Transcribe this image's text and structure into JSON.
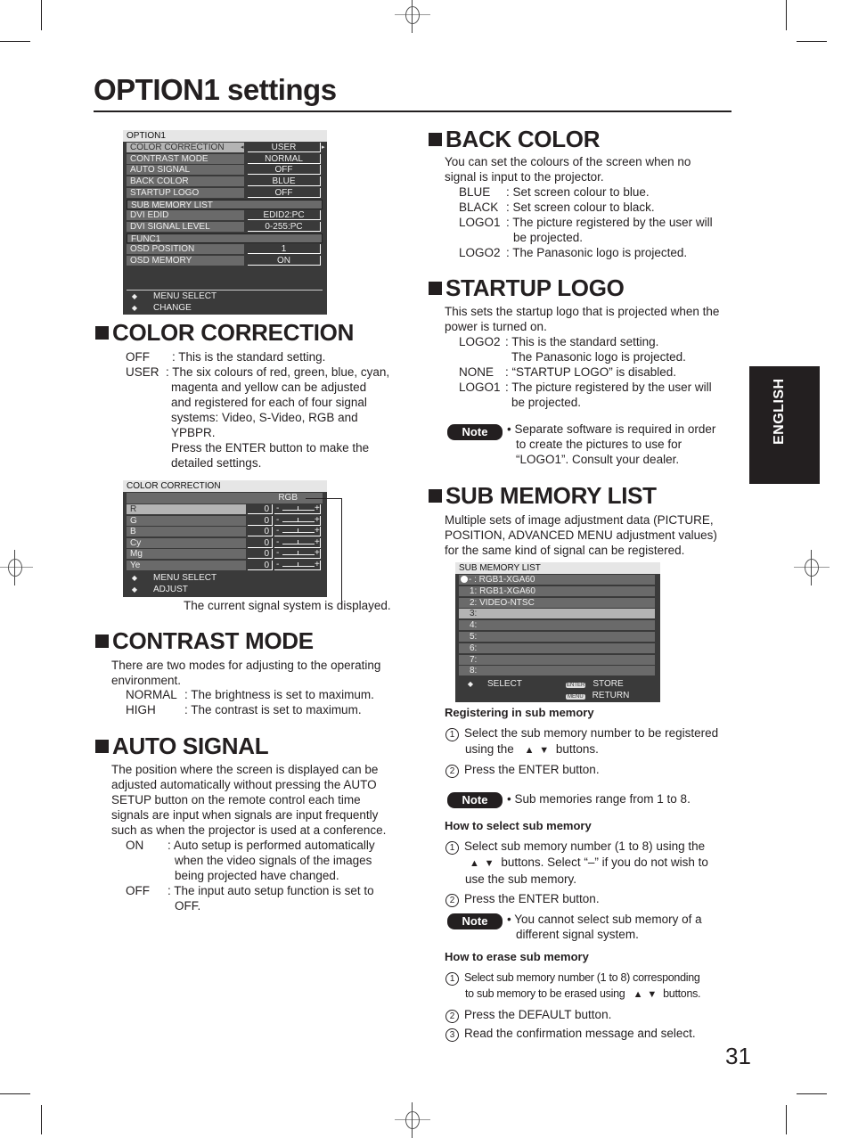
{
  "page": {
    "title": "OPTION1 settings",
    "page_number": "31",
    "language_tab": "ENGLISH"
  },
  "option1_menu": {
    "header": "OPTION1",
    "rows": [
      {
        "label": "COLOR CORRECTION",
        "value": "USER",
        "selected": true
      },
      {
        "label": "CONTRAST MODE",
        "value": "NORMAL"
      },
      {
        "label": "AUTO SIGNAL",
        "value": "OFF"
      },
      {
        "label": "BACK COLOR",
        "value": "BLUE"
      },
      {
        "label": "STARTUP LOGO",
        "value": "OFF"
      },
      {
        "label": "SUB MEMORY LIST",
        "value": ""
      },
      {
        "label": "DVI EDID",
        "value": "EDID2:PC"
      },
      {
        "label": "DVI SIGNAL LEVEL",
        "value": "0-255:PC"
      },
      {
        "label": "FUNC1",
        "value": ""
      },
      {
        "label": "OSD POSITION",
        "value": "1"
      },
      {
        "label": "OSD MEMORY",
        "value": "ON"
      }
    ],
    "footer": [
      {
        "icon": "up-down-arrows-icon",
        "label": "MENU SELECT"
      },
      {
        "icon": "left-right-arrows-icon",
        "label": "CHANGE"
      }
    ]
  },
  "color_correction": {
    "heading": "COLOR CORRECTION",
    "defs": [
      {
        "key": "OFF",
        "text": ": This is the standard setting."
      },
      {
        "key": "USER",
        "text": ": The six colours of red, green, blue, cyan, magenta and yellow can be adjusted and registered for each of four signal systems: Video, S-Video, RGB and YPBPR. Press the ENTER button to make the detailed settings."
      }
    ],
    "user_lines": [
      ": The six colours of red, green, blue, cyan,",
      "magenta and yellow can be adjusted",
      "and registered for each of four signal",
      "systems: Video, S-Video, RGB and",
      "YPBPR.",
      "Press the ENTER button to make the",
      "detailed settings."
    ],
    "menu": {
      "header": "COLOR CORRECTION",
      "signal": "RGB",
      "rows": [
        {
          "label": "R",
          "value": "0"
        },
        {
          "label": "G",
          "value": "0"
        },
        {
          "label": "B",
          "value": "0"
        },
        {
          "label": "Cy",
          "value": "0"
        },
        {
          "label": "Mg",
          "value": "0"
        },
        {
          "label": "Ye",
          "value": "0"
        }
      ],
      "slider_minus": "-",
      "slider_plus": "+",
      "footer": [
        {
          "icon": "up-down-arrows-icon",
          "label": "MENU SELECT"
        },
        {
          "icon": "left-right-arrows-icon",
          "label": "ADJUST"
        }
      ]
    },
    "callout": "The current signal system is displayed."
  },
  "contrast_mode": {
    "heading": "CONTRAST MODE",
    "intro": [
      "There are two modes for adjusting to the operating",
      "environment."
    ],
    "defs": [
      {
        "key": "NORMAL",
        "text": ": The brightness is set to maximum."
      },
      {
        "key": "HIGH",
        "text": ": The contrast is set to maximum."
      }
    ]
  },
  "auto_signal": {
    "heading": "AUTO SIGNAL",
    "intro": [
      "The position where the screen is displayed can be",
      "adjusted automatically without pressing the AUTO",
      "SETUP button on the remote control each time",
      "signals are input when signals are input frequently",
      "such as when the projector is used at a conference."
    ],
    "defs": [
      {
        "key": "ON",
        "lines": [
          ": Auto setup is performed automatically",
          "when the video signals of the images",
          "being projected have changed."
        ]
      },
      {
        "key": "OFF",
        "lines": [
          ": The input auto setup function is set to",
          "OFF."
        ]
      }
    ]
  },
  "back_color": {
    "heading": "BACK COLOR",
    "intro": [
      "You can set the colours of the screen when no",
      "signal is input to the projector."
    ],
    "defs": [
      {
        "key": "BLUE",
        "lines": [
          ": Set screen colour to blue."
        ]
      },
      {
        "key": "BLACK",
        "lines": [
          ": Set screen colour to black."
        ]
      },
      {
        "key": "LOGO1",
        "lines": [
          ": The picture registered by the user will",
          "be projected."
        ]
      },
      {
        "key": "LOGO2",
        "lines": [
          ": The Panasonic logo is projected."
        ]
      }
    ]
  },
  "startup_logo": {
    "heading": "STARTUP LOGO",
    "intro": [
      "This sets the startup logo that is projected when the",
      "power is turned on."
    ],
    "defs": [
      {
        "key": "LOGO2",
        "lines": [
          ": This is the standard setting.",
          "The Panasonic logo is projected."
        ]
      },
      {
        "key": "NONE",
        "lines": [
          ": “STARTUP LOGO” is disabled."
        ]
      },
      {
        "key": "LOGO1",
        "lines": [
          ": The picture registered by the user will",
          "be projected."
        ]
      }
    ],
    "note_label": "Note",
    "note_lines": [
      "• Separate software is required in order",
      "to create the pictures to use for",
      "“LOGO1”. Consult your dealer."
    ]
  },
  "sub_memory_list": {
    "heading": "SUB MEMORY LIST",
    "intro": [
      "Multiple sets of image adjustment data (PICTURE,",
      "POSITION, ADVANCED MENU adjustment values)",
      "for the same kind of signal can be registered."
    ],
    "menu": {
      "header": "SUB MEMORY LIST",
      "rows": [
        {
          "label": "- : RGB1-XGA60",
          "current": true
        },
        {
          "label": "1: RGB1-XGA60"
        },
        {
          "label": "2: VIDEO-NTSC"
        },
        {
          "label": "3:",
          "selected": true
        },
        {
          "label": "4:"
        },
        {
          "label": "5:"
        },
        {
          "label": "6:"
        },
        {
          "label": "7:"
        },
        {
          "label": "8:"
        }
      ],
      "footer_select": "SELECT",
      "footer_enter_key": "ENTER",
      "footer_store": "STORE",
      "footer_menu_key": "MENU",
      "footer_return": "RETURN"
    },
    "registering": {
      "title": "Registering in sub memory",
      "step1_lines": [
        "Select the sub memory number to be registered",
        "using the",
        "buttons."
      ],
      "step2": "Press the ENTER button.",
      "note_label": "Note",
      "note": "• Sub memories range from 1 to 8."
    },
    "selecting": {
      "title": "How to select sub memory",
      "step1_lines": [
        "Select sub memory number (1 to 8) using the",
        "buttons. Select “–” if you do not wish to",
        "use the sub memory."
      ],
      "step2": "Press the ENTER button.",
      "note_label": "Note",
      "note_lines": [
        "• You cannot select sub memory of a",
        "different signal system."
      ]
    },
    "erasing": {
      "title": "How to erase sub memory",
      "step1_lines": [
        "Select sub memory number (1 to 8) corresponding",
        "to sub memory to be erased using",
        "buttons."
      ],
      "step2": "Press the DEFAULT button.",
      "step3": "Read the confirmation message and select."
    },
    "step_numbers": [
      "1",
      "2",
      "3"
    ],
    "up_arrow": "▲",
    "down_arrow": "▼"
  }
}
